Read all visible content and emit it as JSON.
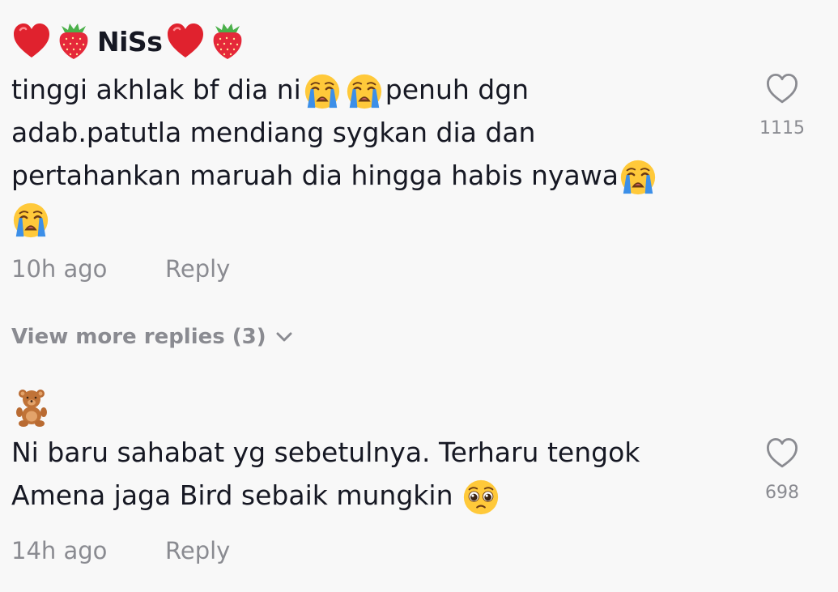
{
  "comments": [
    {
      "username": "NiSs",
      "username_emojis_before": [
        "red-heart",
        "strawberry"
      ],
      "username_emojis_after": [
        "red-heart",
        "strawberry"
      ],
      "text_line1": "tinggi akhlak bf dia ni",
      "text_line1b": "penuh dgn",
      "text_line2": "adab.patutla mendiang sygkan dia dan",
      "text_line3": "pertahankan maruah dia hingga habis nyawa",
      "emojis": [
        "loudly-crying-face",
        "loudly-crying-face",
        "loudly-crying-face",
        "loudly-crying-face"
      ],
      "time": "10h ago",
      "reply_label": "Reply",
      "like_count": "1115"
    },
    {
      "username_emoji": "teddy-bear",
      "text_line1": "Ni baru sahabat yg sebetulnya. Terharu tengok",
      "text_line2": "Amena jaga Bird sebaik mungkin ",
      "emojis": [
        "pleading-face"
      ],
      "time": "14h ago",
      "reply_label": "Reply",
      "like_count": "698"
    }
  ],
  "view_more_replies": "View more replies (3)",
  "colors": {
    "background": "#f8f8f8",
    "text": "#161823",
    "muted": "#8a8b91",
    "heart_red": "#e0222e",
    "emoji_yellow": "#ffc93a",
    "tear_blue": "#3c8fe8"
  }
}
